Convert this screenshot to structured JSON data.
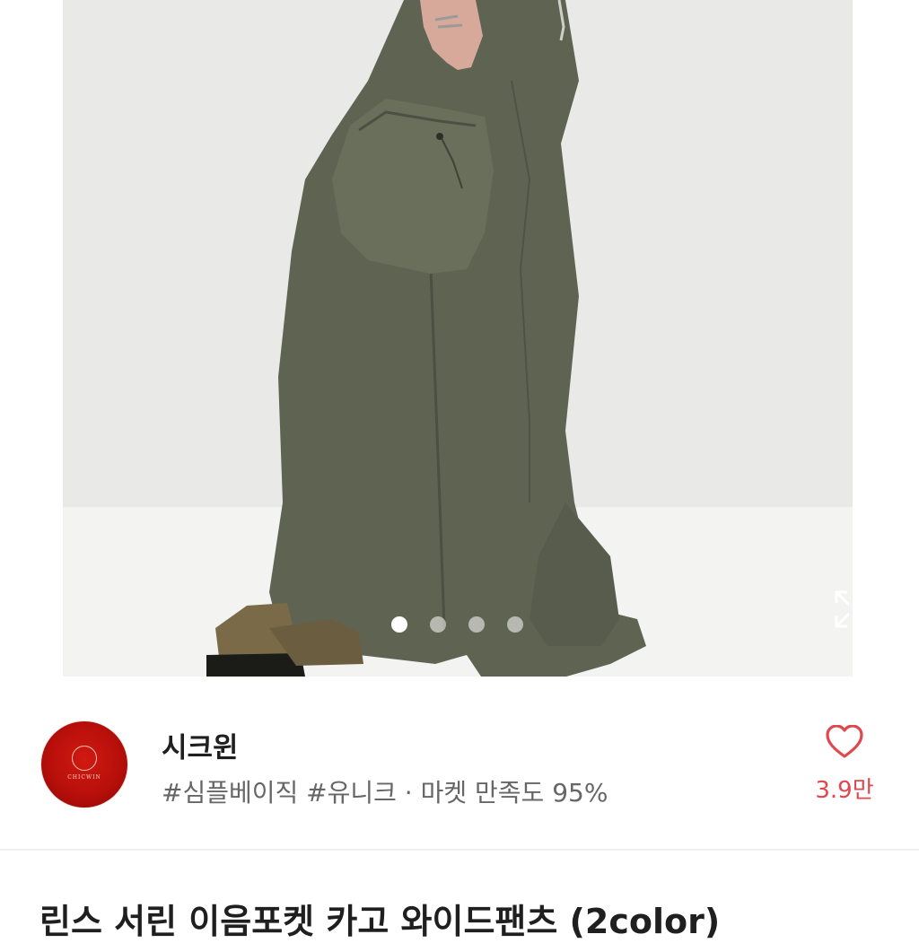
{
  "gallery": {
    "page_count": 4,
    "current_page": 1,
    "background_color": "#e9e9e8",
    "expand_icon": "expand-arrows-icon"
  },
  "shop": {
    "name": "시크윈",
    "logo_text": "CHICWIN",
    "tags_and_rating": "#심플베이직 #유니크 · 마켓 만족도 95%",
    "like_icon": "heart-outline-icon",
    "like_count": "3.9만",
    "accent_color": "#e0484d"
  },
  "product": {
    "title": "린스 서린 이음포켓 카고 와이드팬츠 (2color)"
  }
}
